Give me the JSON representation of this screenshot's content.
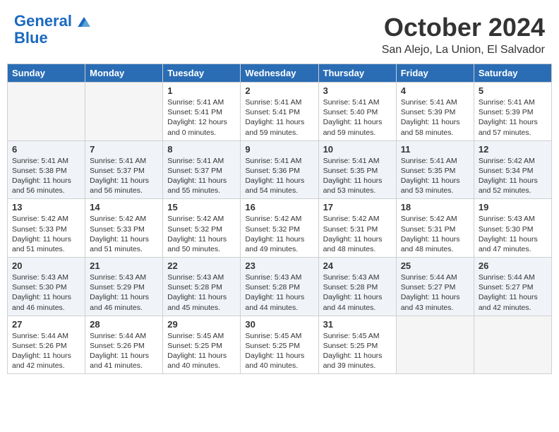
{
  "header": {
    "logo_line1": "General",
    "logo_line2": "Blue",
    "month": "October 2024",
    "location": "San Alejo, La Union, El Salvador"
  },
  "weekdays": [
    "Sunday",
    "Monday",
    "Tuesday",
    "Wednesday",
    "Thursday",
    "Friday",
    "Saturday"
  ],
  "weeks": [
    [
      {
        "day": "",
        "sunrise": "",
        "sunset": "",
        "daylight": ""
      },
      {
        "day": "",
        "sunrise": "",
        "sunset": "",
        "daylight": ""
      },
      {
        "day": "1",
        "sunrise": "Sunrise: 5:41 AM",
        "sunset": "Sunset: 5:41 PM",
        "daylight": "Daylight: 12 hours and 0 minutes."
      },
      {
        "day": "2",
        "sunrise": "Sunrise: 5:41 AM",
        "sunset": "Sunset: 5:41 PM",
        "daylight": "Daylight: 11 hours and 59 minutes."
      },
      {
        "day": "3",
        "sunrise": "Sunrise: 5:41 AM",
        "sunset": "Sunset: 5:40 PM",
        "daylight": "Daylight: 11 hours and 59 minutes."
      },
      {
        "day": "4",
        "sunrise": "Sunrise: 5:41 AM",
        "sunset": "Sunset: 5:39 PM",
        "daylight": "Daylight: 11 hours and 58 minutes."
      },
      {
        "day": "5",
        "sunrise": "Sunrise: 5:41 AM",
        "sunset": "Sunset: 5:39 PM",
        "daylight": "Daylight: 11 hours and 57 minutes."
      }
    ],
    [
      {
        "day": "6",
        "sunrise": "Sunrise: 5:41 AM",
        "sunset": "Sunset: 5:38 PM",
        "daylight": "Daylight: 11 hours and 56 minutes."
      },
      {
        "day": "7",
        "sunrise": "Sunrise: 5:41 AM",
        "sunset": "Sunset: 5:37 PM",
        "daylight": "Daylight: 11 hours and 56 minutes."
      },
      {
        "day": "8",
        "sunrise": "Sunrise: 5:41 AM",
        "sunset": "Sunset: 5:37 PM",
        "daylight": "Daylight: 11 hours and 55 minutes."
      },
      {
        "day": "9",
        "sunrise": "Sunrise: 5:41 AM",
        "sunset": "Sunset: 5:36 PM",
        "daylight": "Daylight: 11 hours and 54 minutes."
      },
      {
        "day": "10",
        "sunrise": "Sunrise: 5:41 AM",
        "sunset": "Sunset: 5:35 PM",
        "daylight": "Daylight: 11 hours and 53 minutes."
      },
      {
        "day": "11",
        "sunrise": "Sunrise: 5:41 AM",
        "sunset": "Sunset: 5:35 PM",
        "daylight": "Daylight: 11 hours and 53 minutes."
      },
      {
        "day": "12",
        "sunrise": "Sunrise: 5:42 AM",
        "sunset": "Sunset: 5:34 PM",
        "daylight": "Daylight: 11 hours and 52 minutes."
      }
    ],
    [
      {
        "day": "13",
        "sunrise": "Sunrise: 5:42 AM",
        "sunset": "Sunset: 5:33 PM",
        "daylight": "Daylight: 11 hours and 51 minutes."
      },
      {
        "day": "14",
        "sunrise": "Sunrise: 5:42 AM",
        "sunset": "Sunset: 5:33 PM",
        "daylight": "Daylight: 11 hours and 51 minutes."
      },
      {
        "day": "15",
        "sunrise": "Sunrise: 5:42 AM",
        "sunset": "Sunset: 5:32 PM",
        "daylight": "Daylight: 11 hours and 50 minutes."
      },
      {
        "day": "16",
        "sunrise": "Sunrise: 5:42 AM",
        "sunset": "Sunset: 5:32 PM",
        "daylight": "Daylight: 11 hours and 49 minutes."
      },
      {
        "day": "17",
        "sunrise": "Sunrise: 5:42 AM",
        "sunset": "Sunset: 5:31 PM",
        "daylight": "Daylight: 11 hours and 48 minutes."
      },
      {
        "day": "18",
        "sunrise": "Sunrise: 5:42 AM",
        "sunset": "Sunset: 5:31 PM",
        "daylight": "Daylight: 11 hours and 48 minutes."
      },
      {
        "day": "19",
        "sunrise": "Sunrise: 5:43 AM",
        "sunset": "Sunset: 5:30 PM",
        "daylight": "Daylight: 11 hours and 47 minutes."
      }
    ],
    [
      {
        "day": "20",
        "sunrise": "Sunrise: 5:43 AM",
        "sunset": "Sunset: 5:30 PM",
        "daylight": "Daylight: 11 hours and 46 minutes."
      },
      {
        "day": "21",
        "sunrise": "Sunrise: 5:43 AM",
        "sunset": "Sunset: 5:29 PM",
        "daylight": "Daylight: 11 hours and 46 minutes."
      },
      {
        "day": "22",
        "sunrise": "Sunrise: 5:43 AM",
        "sunset": "Sunset: 5:28 PM",
        "daylight": "Daylight: 11 hours and 45 minutes."
      },
      {
        "day": "23",
        "sunrise": "Sunrise: 5:43 AM",
        "sunset": "Sunset: 5:28 PM",
        "daylight": "Daylight: 11 hours and 44 minutes."
      },
      {
        "day": "24",
        "sunrise": "Sunrise: 5:43 AM",
        "sunset": "Sunset: 5:28 PM",
        "daylight": "Daylight: 11 hours and 44 minutes."
      },
      {
        "day": "25",
        "sunrise": "Sunrise: 5:44 AM",
        "sunset": "Sunset: 5:27 PM",
        "daylight": "Daylight: 11 hours and 43 minutes."
      },
      {
        "day": "26",
        "sunrise": "Sunrise: 5:44 AM",
        "sunset": "Sunset: 5:27 PM",
        "daylight": "Daylight: 11 hours and 42 minutes."
      }
    ],
    [
      {
        "day": "27",
        "sunrise": "Sunrise: 5:44 AM",
        "sunset": "Sunset: 5:26 PM",
        "daylight": "Daylight: 11 hours and 42 minutes."
      },
      {
        "day": "28",
        "sunrise": "Sunrise: 5:44 AM",
        "sunset": "Sunset: 5:26 PM",
        "daylight": "Daylight: 11 hours and 41 minutes."
      },
      {
        "day": "29",
        "sunrise": "Sunrise: 5:45 AM",
        "sunset": "Sunset: 5:25 PM",
        "daylight": "Daylight: 11 hours and 40 minutes."
      },
      {
        "day": "30",
        "sunrise": "Sunrise: 5:45 AM",
        "sunset": "Sunset: 5:25 PM",
        "daylight": "Daylight: 11 hours and 40 minutes."
      },
      {
        "day": "31",
        "sunrise": "Sunrise: 5:45 AM",
        "sunset": "Sunset: 5:25 PM",
        "daylight": "Daylight: 11 hours and 39 minutes."
      },
      {
        "day": "",
        "sunrise": "",
        "sunset": "",
        "daylight": ""
      },
      {
        "day": "",
        "sunrise": "",
        "sunset": "",
        "daylight": ""
      }
    ]
  ]
}
